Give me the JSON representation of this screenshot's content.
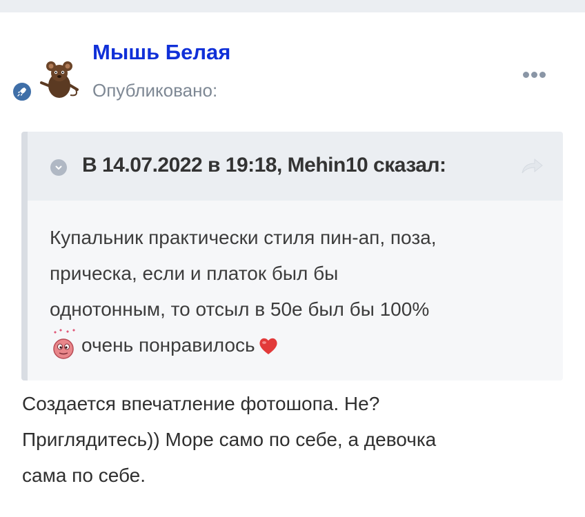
{
  "post": {
    "author": "Мышь Белая",
    "published_label": "Опубликовано:",
    "avatar_icon": "mouse-avatar-icon",
    "rank_icon": "rocket-icon",
    "menu_icon": "more-icon",
    "quote": {
      "citation": "В 14.07.2022 в 19:18, Mehin10 сказал:",
      "toggle_icon": "chevron-down-icon",
      "share_icon": "share-arrow-icon",
      "lines": [
        "Купальник практически стиля пин-ап, поза,",
        "прическа, если и платок был бы",
        "однотонным, то отсыл в 50е был бы 100%"
      ],
      "last_line": "очень понравилось",
      "emoji_before": "blushing-face-icon",
      "emoji_after": "heart-icon"
    },
    "text_lines": [
      "Создается впечатление фотошопа. Не?",
      "Приглядитесь)) Море само по себе, а девочка",
      "сама по себе."
    ]
  },
  "colors": {
    "author": "#1030d8",
    "muted": "#7e8894",
    "quote_header_bg": "#ebeef2",
    "quote_bg": "#f6f7f9",
    "rank_badge": "#3f6fa8"
  }
}
